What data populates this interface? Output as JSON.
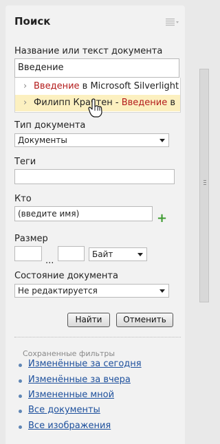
{
  "panel": {
    "title": "Поиск"
  },
  "doc_name": {
    "label": "Название или текст документа",
    "value": "Введение"
  },
  "suggestions": {
    "items": [
      {
        "highlight": "Введение",
        "rest": " в Microsoft Silverlight"
      },
      {
        "prefix": "Филипп Крачтен - ",
        "highlight": "Введение",
        "rest": " в"
      }
    ]
  },
  "doc_type": {
    "label": "Тип документа",
    "selected": "Документы"
  },
  "tags": {
    "label": "Теги",
    "value": ""
  },
  "who": {
    "label": "Кто",
    "value": "(введите имя)"
  },
  "size": {
    "label": "Размер",
    "from": "",
    "separator": "...",
    "to": "",
    "unit": "Байт"
  },
  "doc_state": {
    "label": "Состояние документа",
    "selected": "Не редактируется"
  },
  "actions": {
    "find": "Найти",
    "cancel": "Отменить"
  },
  "saved_filters": {
    "header": "Сохраненные фильтры",
    "items": [
      "Изменённые за сегодня",
      "Изменённые за вчера",
      "Измененные мной",
      "Все документы",
      "Все изображения"
    ]
  },
  "colors": {
    "highlight_text": "#b31b1b",
    "link": "#1c4f9c",
    "suggestion_hover": "#fcf0c0",
    "add_icon": "#3c9a2f"
  },
  "icons": {
    "menu": "menu-lines-icon",
    "add": "plus-icon",
    "chevron": "chevron-right-icon",
    "cursor": "hand-pointer-icon"
  }
}
